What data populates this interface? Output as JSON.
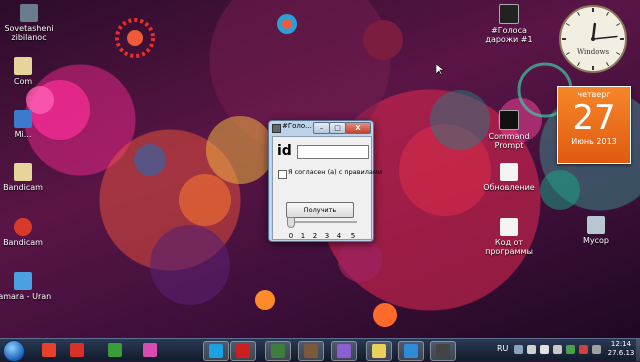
{
  "desktop": {
    "icons": [
      {
        "label": "Sovetasheni zibilanoc",
        "icon": "folder-icon"
      },
      {
        "label": "Com",
        "icon": "file-icon"
      },
      {
        "label": "Mi...",
        "icon": "app-icon"
      },
      {
        "label": "Bandicam",
        "icon": "file-icon"
      },
      {
        "label": "Bandicam",
        "icon": "bandicam-icon"
      },
      {
        "label": "Tamara - Uran",
        "icon": "audio-file-icon"
      },
      {
        "label": "#Голоса дарожи #1",
        "icon": "mw-game-icon"
      },
      {
        "label": "Command Prompt",
        "icon": "cmd-icon"
      },
      {
        "label": "Обновление",
        "icon": "document-icon"
      },
      {
        "label": "Код от программы",
        "icon": "document-icon"
      },
      {
        "label": "Мусор",
        "icon": "recycle-bin-icon"
      }
    ]
  },
  "clock": {
    "brand": "Windows",
    "hour": 12,
    "minute": 14
  },
  "calendar": {
    "weekday": "четверг",
    "day": "27",
    "month_year": "Июнь 2013",
    "accent": "#f27a20"
  },
  "window": {
    "title": "#Голо...",
    "minimize": "–",
    "maximize": "□",
    "close": "X",
    "id_label": "id",
    "id_value": "",
    "agree_label": "Я согласен (а) с правилами",
    "agree_checked": false,
    "button_label": "Получить",
    "slider_value": 0,
    "ticks": [
      "0",
      "1",
      "2",
      "3",
      "4",
      "5"
    ]
  },
  "taskbar": {
    "items": [
      {
        "name": "yandex-browser-icon",
        "color": "#e8402a"
      },
      {
        "name": "yandex-icon",
        "color": "#d9302a"
      },
      {
        "name": "chrome-icon",
        "color": "#3a9d3a"
      },
      {
        "name": "media-player-icon",
        "color": "#d84bb0"
      },
      {
        "name": "skype-icon",
        "color": "#1ba1e2"
      },
      {
        "name": "opera-icon",
        "color": "#cc1f1f"
      },
      {
        "name": "game-icon",
        "color": "#3d7d3d"
      },
      {
        "name": "game-icon-2",
        "color": "#7a5a3a"
      },
      {
        "name": "picasa-icon",
        "color": "#8b5fd0"
      },
      {
        "name": "notes-icon",
        "color": "#e8d05a"
      },
      {
        "name": "network-icon",
        "color": "#2f8ad8"
      },
      {
        "name": "mw-icon",
        "color": "#444444"
      }
    ],
    "tray": {
      "language": "RU",
      "time": "12:14",
      "date": "27.6.13"
    }
  }
}
